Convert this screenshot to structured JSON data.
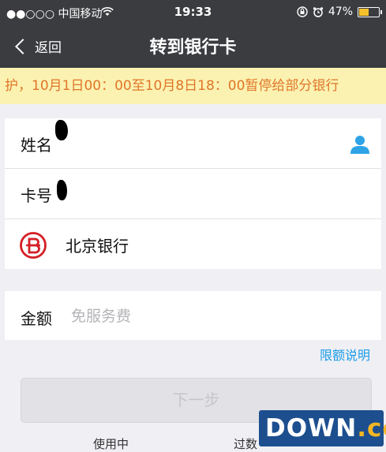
{
  "status_bar": {
    "carrier": "●●○○○ 中国移动",
    "time": "19:33",
    "battery": "47%",
    "battery_level": 0.47
  },
  "nav": {
    "back_label": "返回",
    "title": "转到银行卡"
  },
  "notice": "护，10月1日00：00至10月8日18：00暂停给部分银行",
  "form": {
    "name_label": "姓名",
    "card_label": "卡号",
    "bank_name": "北京银行",
    "amount_label": "金额",
    "amount_placeholder": "免服务费"
  },
  "limit_link": "限额说明",
  "next_button": "下一步",
  "footer": {
    "left": "使用中",
    "right": "过数"
  },
  "watermark": {
    "text": "DOWN",
    "suffix": ".cc"
  },
  "colors": {
    "nav_bg": "#3b3c40",
    "notice_bg": "#fbf2b1",
    "notice_text": "#e0762a",
    "link": "#1c9de8",
    "bank_red": "#d41f26",
    "person_icon": "#2ea3e6"
  },
  "icons": {
    "person": "person-icon",
    "bank": "beijing-bank-logo",
    "back": "chevron-left-icon"
  }
}
